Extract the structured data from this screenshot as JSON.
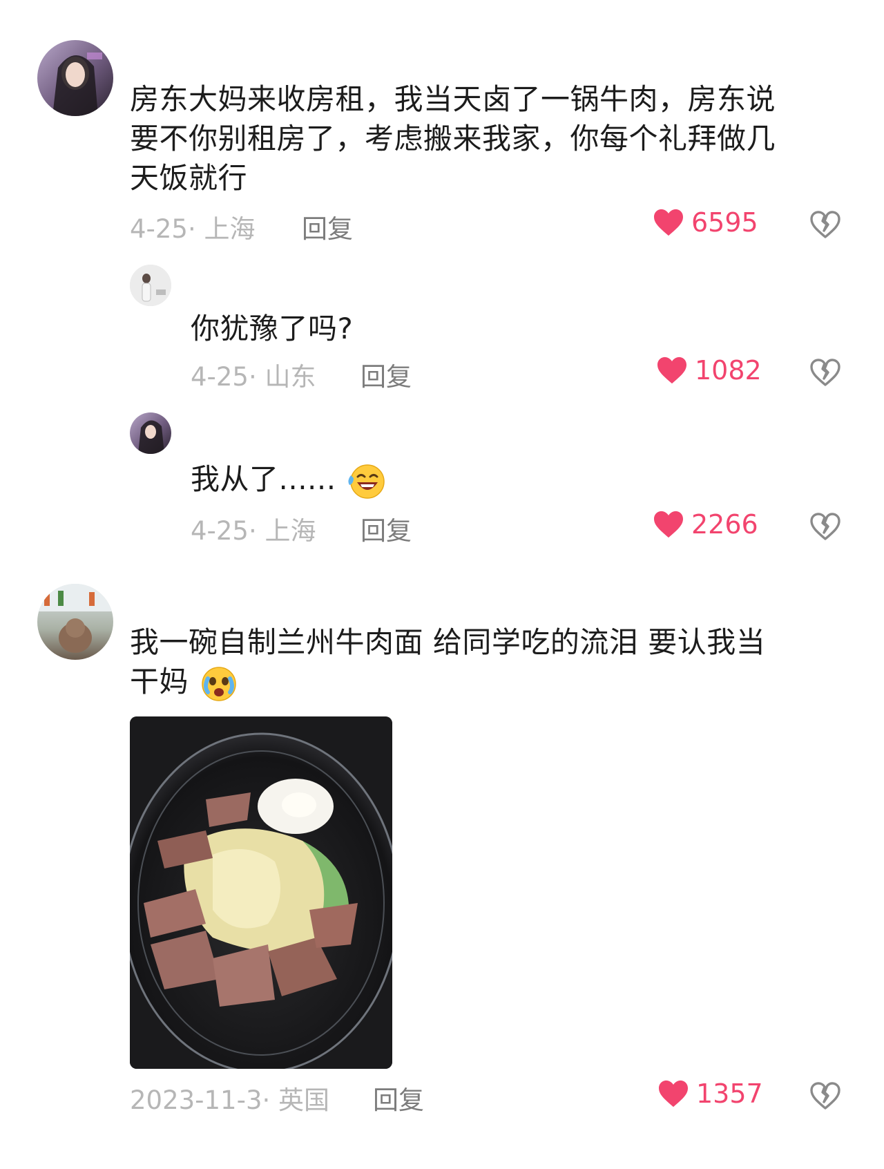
{
  "comments": [
    {
      "text": "房东大妈来收房租，我当天卤了一锅牛肉，房东说要不你别租房了，考虑搬来我家，你每个礼拜做几天饭就行",
      "line1": "房东大妈来收房租，我当天卤了一锅牛肉，房东说",
      "line2": "要不你别租房了，考虑搬来我家，你每个礼拜做几",
      "line3": "天饭就行",
      "meta": "4-25· 上海",
      "reply": "回复",
      "likes": "6595"
    },
    {
      "text": "你犹豫了吗?",
      "meta": "4-25· 山东",
      "reply": "回复",
      "likes": "1082"
    },
    {
      "text": "我从了......",
      "meta": "4-25· 上海",
      "reply": "回复",
      "likes": "2266"
    },
    {
      "line1": "我一碗自制兰州牛肉面 给同学吃的流泪 要认我当",
      "line2": "干妈",
      "meta": "2023-11-3· 英国",
      "reply": "回复",
      "likes": "1357"
    }
  ],
  "colors": {
    "like": "#f2446e",
    "meta": "#b6b6b6",
    "reply": "#7c7c7c",
    "text": "#1c1c1c"
  },
  "icons": [
    "heart-icon",
    "broken-heart-icon",
    "laughing-tears-emoji",
    "crying-emoji"
  ]
}
